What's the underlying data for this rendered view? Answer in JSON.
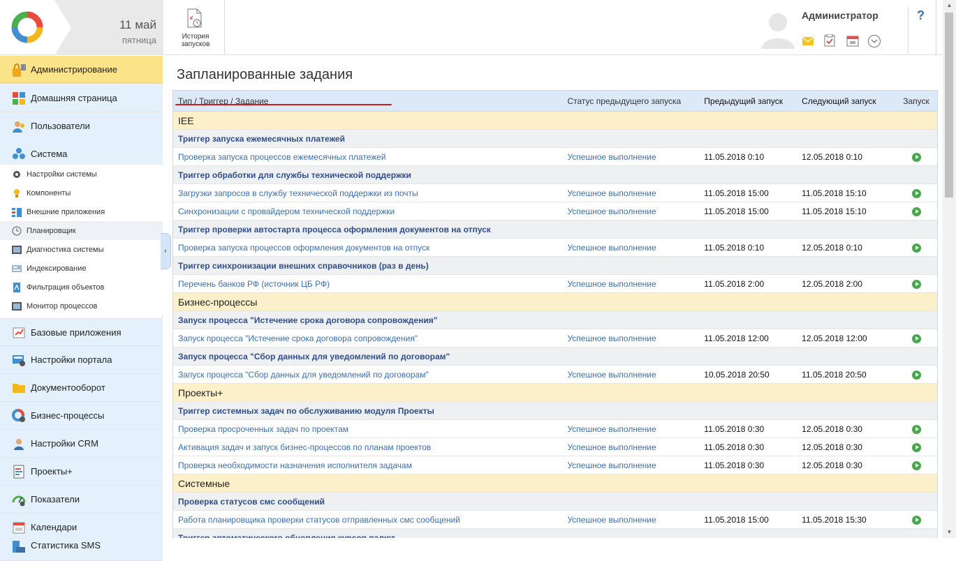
{
  "header": {
    "date_day": "11 май",
    "date_weekday": "пятница",
    "history_label": "История запусков",
    "user_name": "Администратор",
    "help": "?"
  },
  "sidebar": {
    "top_items": [
      {
        "label": "Администрирование"
      },
      {
        "label": "Домашняя страница"
      },
      {
        "label": "Пользователи"
      },
      {
        "label": "Система"
      }
    ],
    "sub_items": [
      {
        "label": "Настройки системы"
      },
      {
        "label": "Компоненты"
      },
      {
        "label": "Внешние приложения"
      },
      {
        "label": "Планировщик"
      },
      {
        "label": "Диагностика системы"
      },
      {
        "label": "Индексирование"
      },
      {
        "label": "Фильтрация объектов"
      },
      {
        "label": "Монитор процессов"
      }
    ],
    "bottom_items": [
      {
        "label": "Базовые приложения"
      },
      {
        "label": "Настройки портала"
      },
      {
        "label": "Документооборот"
      },
      {
        "label": "Бизнес-процессы"
      },
      {
        "label": "Настройки CRM"
      },
      {
        "label": "Проекты+"
      },
      {
        "label": "Показатели"
      },
      {
        "label": "Календари"
      },
      {
        "label": "Статистика SMS"
      }
    ]
  },
  "main": {
    "title": "Запланированные задания",
    "columns": {
      "type": "Тип / Триггер / Задание",
      "status": "Статус предыдущего запуска",
      "prev": "Предыдущий запуск",
      "next": "Следующий запуск",
      "run": "Запуск"
    },
    "rows": [
      {
        "kind": "grp",
        "name": "IEE"
      },
      {
        "kind": "trig",
        "name": "Триггер запуска ежемесячных платежей"
      },
      {
        "kind": "task",
        "name": "Проверка запуска процессов ежемесячных платежей",
        "status": "Успешное выполнение",
        "prev": "11.05.2018 0:10",
        "next": "12.05.2018 0:10"
      },
      {
        "kind": "trig",
        "name": "Триггер обработки для службы технической поддержки"
      },
      {
        "kind": "task",
        "name": "Загрузки запросов в службу технической поддержки из почты",
        "status": "Успешное выполнение",
        "prev": "11.05.2018 15:00",
        "next": "11.05.2018 15:10"
      },
      {
        "kind": "task",
        "name": "Синхронизации с провайдером технической поддержки",
        "status": "Успешное выполнение",
        "prev": "11.05.2018 15:00",
        "next": "11.05.2018 15:10"
      },
      {
        "kind": "trig",
        "name": "Триггер проверки автостарта процесса оформления документов на отпуск"
      },
      {
        "kind": "task",
        "name": "Проверка запуска процессов оформления документов на отпуск",
        "status": "Успешное выполнение",
        "prev": "11.05.2018 0:10",
        "next": "12.05.2018 0:10"
      },
      {
        "kind": "trig",
        "name": "Триггер синхронизации внешних справочников (раз в день)"
      },
      {
        "kind": "task",
        "name": "Перечень банков РФ (источник ЦБ РФ)",
        "status": "Успешное выполнение",
        "prev": "11.05.2018 2:00",
        "next": "12.05.2018 2:00"
      },
      {
        "kind": "grp",
        "name": "Бизнес-процессы"
      },
      {
        "kind": "trig",
        "name": "Запуск процесса \"Истечение срока договора сопровождения\""
      },
      {
        "kind": "task",
        "name": "Запуск процесса \"Истечение срока договора сопровождения\"",
        "status": "Успешное выполнение",
        "prev": "11.05.2018 12:00",
        "next": "12.05.2018 12:00"
      },
      {
        "kind": "trig",
        "name": "Запуск процесса \"Сбор данных для уведомлений по договорам\""
      },
      {
        "kind": "task",
        "name": "Запуск процесса \"Сбор данных для уведомлений по договорам\"",
        "status": "Успешное выполнение",
        "prev": "10.05.2018 20:50",
        "next": "11.05.2018 20:50"
      },
      {
        "kind": "grp",
        "name": "Проекты+"
      },
      {
        "kind": "trig",
        "name": "Триггер системных задач по обслуживанию модуля Проекты"
      },
      {
        "kind": "task",
        "name": "Проверка просроченных задач по проектам",
        "status": "Успешное выполнение",
        "prev": "11.05.2018 0:30",
        "next": "12.05.2018 0:30"
      },
      {
        "kind": "task",
        "name": "Активация задач и запуск бизнес-процессов по планам проектов",
        "status": "Успешное выполнение",
        "prev": "11.05.2018 0:30",
        "next": "12.05.2018 0:30"
      },
      {
        "kind": "task",
        "name": "Проверка необходимости назначения исполнителя задачам",
        "status": "Успешное выполнение",
        "prev": "11.05.2018 0:30",
        "next": "12.05.2018 0:30"
      },
      {
        "kind": "grp",
        "name": "Системные"
      },
      {
        "kind": "trig",
        "name": "Проверка статусов смс сообщений"
      },
      {
        "kind": "task",
        "name": "Работа планировщика проверки статусов отправленных смс сообщений",
        "status": "Успешное выполнение",
        "prev": "11.05.2018 15:00",
        "next": "11.05.2018 15:30"
      },
      {
        "kind": "trig",
        "name": "Триггер автоматического обновления курсов валют"
      }
    ]
  },
  "colors": {
    "accent": "#3a6fb5",
    "active_menu": "#fbe38a",
    "group_row": "#fcf0ca",
    "run_green": "#45a84a",
    "underline_red": "#d11a1a"
  }
}
